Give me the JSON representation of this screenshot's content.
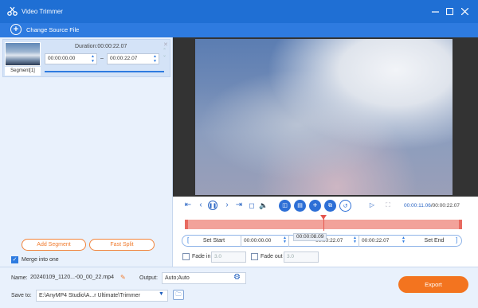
{
  "window": {
    "title": "Video Trimmer"
  },
  "toolbar": {
    "change_source_label": "Change Source File"
  },
  "segment": {
    "thumb_label": "Segment[1]",
    "duration_label": "Duration:00:00:22.07",
    "start_time": "00:00:00.00",
    "end_time": "00:00:22.07",
    "separator": "–"
  },
  "left_actions": {
    "add_segment": "Add Segment",
    "fast_split": "Fast Split",
    "merge_label": "Merge into one",
    "merge_checked": true
  },
  "player": {
    "current_time": "00:00:11.06",
    "total_time": "00:00:22.07",
    "progress_fraction": 0.5
  },
  "trim": {
    "tooltip_time": "00:00:08.09",
    "set_start_label": "Set Start",
    "start_time": "00:00:00.00",
    "end_field_a": "00:00:22.07",
    "end_field_b": "00:00:22.07",
    "set_end_label": "Set End",
    "bracket_open": "[",
    "bracket_close": "]"
  },
  "fade": {
    "fade_in_label": "Fade in",
    "fade_in_value": "3.0",
    "fade_out_label": "Fade out",
    "fade_out_value": "3.0"
  },
  "bottom": {
    "name_label": "Name:",
    "name_value": "20240109_1120...-00_00_22.mp4",
    "output_label": "Output:",
    "output_value": "Auto;Auto",
    "save_to_label": "Save to:",
    "save_to_value": "E:\\AnyMP4 Studio\\A...r Ultimate\\Trimmer",
    "export_label": "Export"
  },
  "colors": {
    "accent": "#1f6fd4",
    "export": "#f3741f",
    "track": "#f2a29a"
  }
}
